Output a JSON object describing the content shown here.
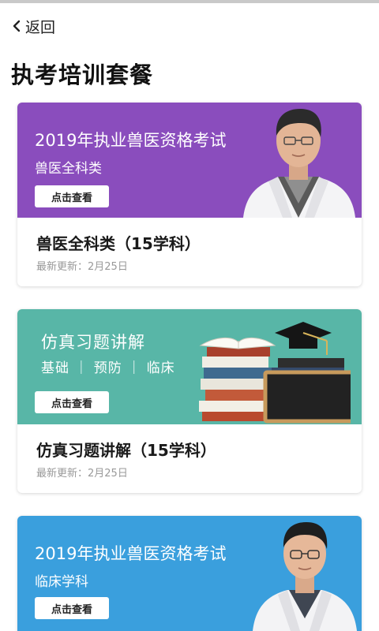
{
  "nav": {
    "back_label": "返回"
  },
  "page": {
    "title": "执考培训套餐"
  },
  "colors": {
    "purple": "#8a4dbd",
    "teal": "#58b6a7",
    "blue": "#3a9fdd"
  },
  "cards": [
    {
      "banner_heading": "2019年执业兽医资格考试",
      "banner_sub": "兽医全科类",
      "button_label": "点击查看",
      "title": "兽医全科类（15学科）",
      "update_prefix": "最新更新：",
      "update_date": "2月25日"
    },
    {
      "banner_heading": "仿真习题讲解",
      "banner_sub": "基础 ｜ 预防 ｜ 临床",
      "button_label": "点击查看",
      "title": "仿真习题讲解（15学科）",
      "update_prefix": "最新更新：",
      "update_date": "2月25日"
    },
    {
      "banner_heading": "2019年执业兽医资格考试",
      "banner_sub": "临床学科",
      "button_label": "点击查看"
    }
  ]
}
